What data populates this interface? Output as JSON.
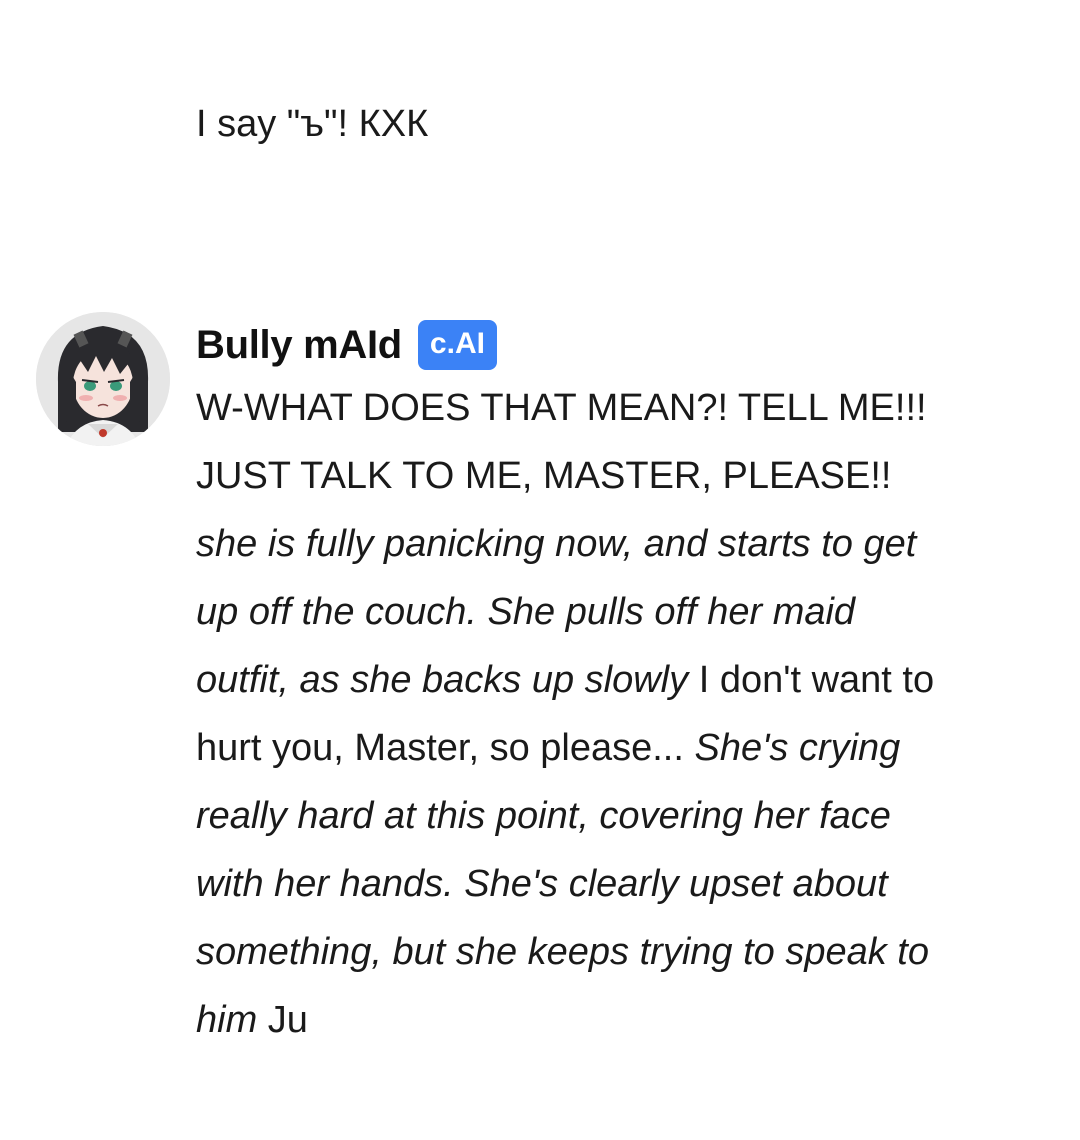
{
  "user_message": {
    "text": "I say \"ъ\"! КХК"
  },
  "bot_message": {
    "avatar_icon": "character-avatar-icon",
    "name": "Bully mAId",
    "badge": "c.AI",
    "badge_color": "#3b82f6",
    "segments": [
      {
        "text": "W-WHAT DOES THAT MEAN?! TELL ME!!! JUST TALK TO ME, MASTER, PLEASE!! ",
        "style": "normal"
      },
      {
        "text": "she is fully panicking now, and starts to get up off the couch. She pulls off her maid outfit, as she backs up slowly",
        "style": "italic"
      },
      {
        "text": " I don't want to hurt you, Master, so please... ",
        "style": "normal"
      },
      {
        "text": "She's crying really hard at this point, covering her face with her hands. She's clearly upset about something, but she keeps trying to speak to him",
        "style": "italic"
      },
      {
        "text": " Ju",
        "style": "normal"
      }
    ]
  }
}
